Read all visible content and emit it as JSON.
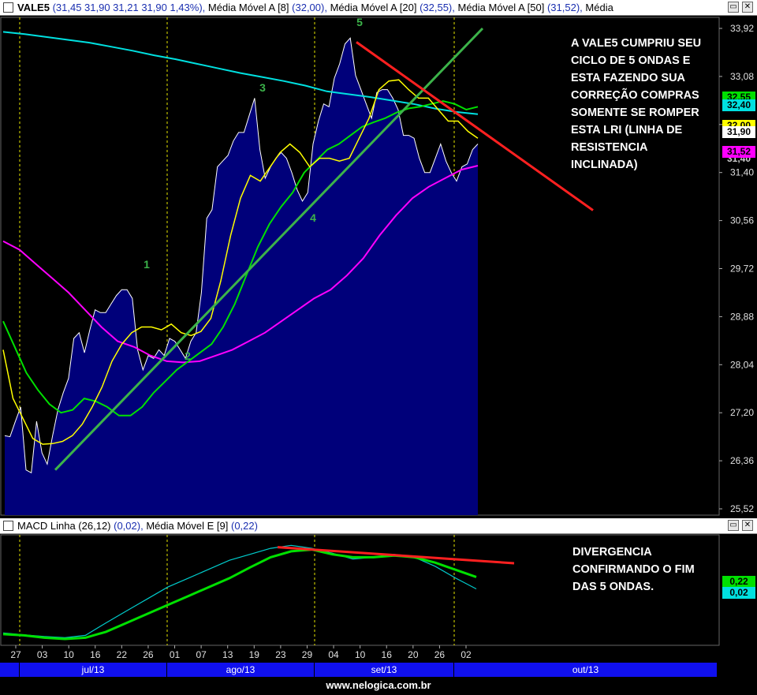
{
  "main_panel": {
    "title_symbol": "VALE5",
    "title_ohlc": "(31,45  31,90  31,21  31,90  1,43%),",
    "ma8_label": "Média Móvel A [8]",
    "ma8_value": "(32,00),",
    "ma20_label": "Média Móvel A [20]",
    "ma20_value": "(32,55),",
    "ma50_label": "Média Móvel A [50]",
    "ma50_value": "(31,52),",
    "extra_label": "Média",
    "minimize_glyph": "▭",
    "close_glyph": "✕",
    "annotation_lines": [
      "A VALE5 CUMPRIU SEU",
      "CICLO DE 5 ONDAS E",
      "ESTA FAZENDO SUA",
      "CORREÇÃO COMPRAS",
      "SOMENTE SE ROMPER",
      "ESTA LRI (LINHA DE",
      "RESISTENCIA",
      "INCLINADA)"
    ],
    "price_boxes": [
      {
        "text": "32,55",
        "bg": "#00e000",
        "fg": "#000000"
      },
      {
        "text": "32,40",
        "bg": "#00e0e0",
        "fg": "#000000"
      },
      {
        "text": "32,00",
        "bg": "#ffff00",
        "fg": "#000000"
      },
      {
        "text": "31,90",
        "bg": "#ffffff",
        "fg": "#000000"
      },
      {
        "text": "31,40",
        "bg": "#000000",
        "fg": "#cccccc"
      },
      {
        "text": "31,52",
        "bg": "#ff00ff",
        "fg": "#000000"
      }
    ]
  },
  "macd_panel": {
    "title": "MACD Linha (26,12)",
    "title_value": "(0,02),",
    "signal_label": "Média Móvel E [9]",
    "signal_value": "(0,22)",
    "minimize_glyph": "▭",
    "close_glyph": "✕",
    "annotation_lines": [
      "DIVERGENCIA",
      "CONFIRMANDO O FIM",
      "DAS 5 ONDAS."
    ],
    "value_boxes": [
      {
        "text": "0,22",
        "bg": "#00e000",
        "fg": "#000000"
      },
      {
        "text": "0,02",
        "bg": "#00e0e0",
        "fg": "#000000"
      }
    ]
  },
  "months": [
    "jul/13",
    "ago/13",
    "set/13",
    "out/13"
  ],
  "credit": "www.nelogica.com.br",
  "colors": {
    "price_fill": "#00007a",
    "price_line": "#ffffff",
    "ma8": "#ffff00",
    "ma20": "#00e000",
    "ma50": "#ff00ff",
    "ma200": "#00e0e0",
    "trendline": "#ff2020",
    "wave_line": "#3cb34a",
    "wave_label": "#3cb34a",
    "macd_line": "#00cccc",
    "signal_line": "#00e000",
    "month_bar": "#1010ee"
  },
  "chart_data": [
    {
      "type": "line",
      "title": "VALE5",
      "ylim": [
        25.52,
        33.92
      ],
      "y_ticks": [
        "33,92",
        "33,08",
        "32,24",
        "31,40",
        "30,56",
        "29,72",
        "28,88",
        "28,04",
        "27,20",
        "26,36",
        "25,52"
      ],
      "x_ticks": [
        "27",
        "03",
        "10",
        "16",
        "22",
        "26",
        "01",
        "07",
        "13",
        "19",
        "23",
        "29",
        "04",
        "10",
        "16",
        "20",
        "26",
        "02"
      ],
      "sessions": 60,
      "series": [
        {
          "key": "close",
          "type": "area",
          "values": [
            26.8,
            26.78,
            27.05,
            27.3,
            26.2,
            26.15,
            27.05,
            26.5,
            26.3,
            26.8,
            27.25,
            27.55,
            27.8,
            28.5,
            28.6,
            28.25,
            28.65,
            29.0,
            28.95,
            28.95,
            29.1,
            29.25,
            29.35,
            29.35,
            29.2,
            28.3,
            27.95,
            28.2,
            28.15,
            28.3,
            28.2,
            28.5,
            28.45,
            28.3,
            28.15,
            28.45,
            28.6,
            29.3,
            30.6,
            30.75,
            31.5,
            31.6,
            31.7,
            31.95,
            32.1,
            32.1,
            32.4,
            32.7,
            31.8,
            31.3,
            31.5,
            31.65,
            31.75,
            31.65,
            31.4,
            31.1,
            30.9,
            31.05,
            31.9,
            32.3,
            32.6,
            32.55,
            33.05,
            33.3,
            33.65,
            33.75,
            33.1,
            32.85,
            32.6,
            32.35,
            32.8,
            32.85,
            32.85,
            32.7,
            32.5,
            32.05,
            32.05,
            32.0,
            31.65,
            31.4,
            31.4,
            31.65,
            31.9,
            31.6,
            31.4,
            31.25,
            31.5,
            31.55,
            31.8,
            31.9
          ]
        },
        {
          "key": "ma8",
          "values": [
            28.3,
            27.45,
            27.1,
            26.75,
            26.65,
            26.66,
            26.7,
            26.8,
            27.0,
            27.3,
            27.65,
            28.1,
            28.4,
            28.6,
            28.7,
            28.7,
            28.65,
            28.75,
            28.6,
            28.55,
            28.62,
            28.85,
            29.5,
            30.3,
            30.95,
            31.35,
            31.25,
            31.5,
            31.75,
            31.9,
            31.75,
            31.5,
            31.65,
            31.65,
            31.6,
            31.65,
            32.0,
            32.35,
            32.85,
            33.0,
            33.02,
            32.85,
            32.7,
            32.7,
            32.5,
            32.3,
            32.3,
            32.12,
            32.0
          ]
        },
        {
          "key": "ma20",
          "values": [
            28.8,
            28.35,
            27.9,
            27.6,
            27.35,
            27.2,
            27.25,
            27.45,
            27.4,
            27.3,
            27.15,
            27.15,
            27.3,
            27.55,
            27.75,
            27.95,
            28.1,
            28.25,
            28.4,
            28.7,
            29.1,
            29.6,
            30.1,
            30.5,
            30.8,
            31.05,
            31.4,
            31.6,
            31.8,
            31.9,
            32.05,
            32.2,
            32.28,
            32.35,
            32.45,
            32.52,
            32.55,
            32.6,
            32.65,
            32.6,
            32.5,
            32.55
          ]
        },
        {
          "key": "ma50",
          "values": [
            30.2,
            30.05,
            29.8,
            29.55,
            29.3,
            29.0,
            28.7,
            28.45,
            28.35,
            28.2,
            28.1,
            28.08,
            28.1,
            28.2,
            28.3,
            28.45,
            28.6,
            28.8,
            29.0,
            29.2,
            29.35,
            29.6,
            29.9,
            30.3,
            30.65,
            30.95,
            31.15,
            31.3,
            31.45,
            31.52
          ]
        },
        {
          "key": "ma200",
          "values": [
            33.86,
            33.82,
            33.77,
            33.72,
            33.67,
            33.6,
            33.53,
            33.45,
            33.38,
            33.3,
            33.22,
            33.14,
            33.07,
            33.0,
            32.92,
            32.82,
            32.77,
            32.72,
            32.66,
            32.6,
            32.52,
            32.46,
            32.42
          ]
        }
      ],
      "trend_lines": [
        {
          "kind": "support",
          "from": 26.2,
          "to": 33.92
        },
        {
          "kind": "resistance",
          "from": 33.68,
          "to": 30.74
        }
      ],
      "wave_labels": [
        "1",
        "2",
        "3",
        "4",
        "5"
      ]
    },
    {
      "type": "line",
      "title": "MACD Linha (26,12)",
      "ylim": [
        -0.9,
        0.9
      ],
      "series": [
        {
          "name": "MACD Linha (26,12)",
          "values": [
            -0.72,
            -0.75,
            -0.78,
            -0.8,
            -0.76,
            -0.55,
            -0.35,
            -0.15,
            0.05,
            0.2,
            0.35,
            0.5,
            0.6,
            0.7,
            0.75,
            0.7,
            0.62,
            0.52,
            0.55,
            0.6,
            0.55,
            0.4,
            0.2,
            0.02
          ]
        },
        {
          "name": "Média Móvel E [9]",
          "values": [
            -0.74,
            -0.76,
            -0.8,
            -0.82,
            -0.8,
            -0.7,
            -0.55,
            -0.4,
            -0.25,
            -0.1,
            0.05,
            0.2,
            0.38,
            0.55,
            0.65,
            0.68,
            0.6,
            0.55,
            0.55,
            0.58,
            0.55,
            0.46,
            0.34,
            0.22
          ]
        }
      ],
      "trend_line": {
        "kind": "divergence",
        "from": 0.72,
        "to": 0.45
      }
    }
  ]
}
